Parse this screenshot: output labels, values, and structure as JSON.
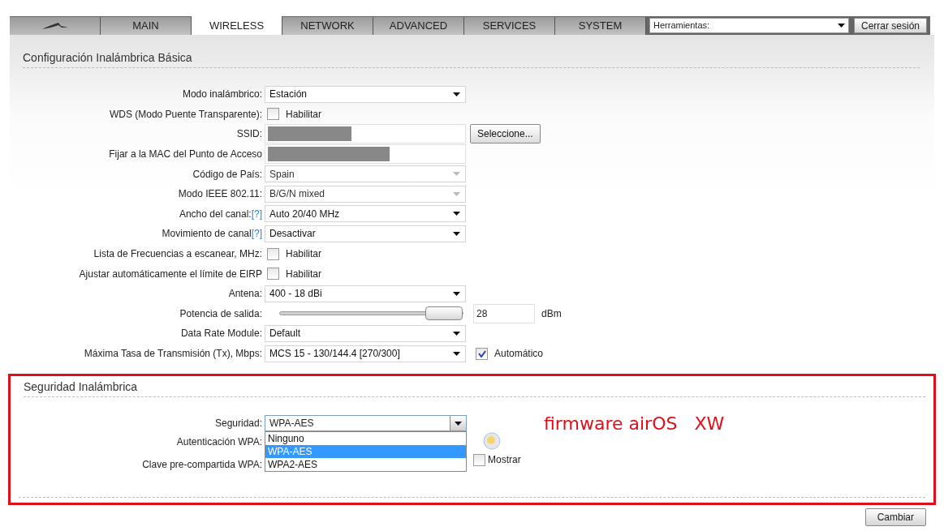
{
  "tabs": [
    {
      "label": "MAIN",
      "selected": false
    },
    {
      "label": "WIRELESS",
      "selected": true
    },
    {
      "label": "NETWORK",
      "selected": false
    },
    {
      "label": "ADVANCED",
      "selected": false
    },
    {
      "label": "SERVICES",
      "selected": false
    },
    {
      "label": "SYSTEM",
      "selected": false
    }
  ],
  "tools_select": {
    "value": "Herramientas:"
  },
  "logout_button": "Cerrar sesión",
  "basic_section": {
    "title": "Configuración Inalámbrica Básica",
    "rows": [
      {
        "kind": "select",
        "label": "Modo inalámbrico:",
        "value": "Estación",
        "disabled": false
      },
      {
        "kind": "checkbox",
        "label": "WDS (Modo Puente Transparente):",
        "text": "Habilitar",
        "checked": false
      },
      {
        "kind": "masked",
        "label": "SSID:",
        "button": "Seleccione..."
      },
      {
        "kind": "masked",
        "label": "Fijar a la MAC del Punto de Acceso"
      },
      {
        "kind": "select",
        "label": "Código de País:",
        "value": "Spain",
        "disabled": true
      },
      {
        "kind": "select",
        "label": "Modo IEEE 802.11:",
        "value": "B/G/N mixed",
        "disabled": true
      },
      {
        "kind": "select",
        "label": "Ancho del canal:",
        "help": "[?]",
        "value": "Auto 20/40 MHz",
        "disabled": false
      },
      {
        "kind": "select",
        "label": "Movimiento de canal",
        "help": "[?]",
        "value": "Desactivar",
        "disabled": false
      },
      {
        "kind": "checkbox",
        "label": "Lista de Frecuencias a escanear, MHz:",
        "text": "Habilitar",
        "checked": false
      },
      {
        "kind": "checkbox",
        "label": "Ajustar automáticamente el límite de EIRP",
        "text": "Habilitar",
        "checked": false
      },
      {
        "kind": "select",
        "label": "Antena:",
        "value": "400 - 18 dBi",
        "disabled": false
      },
      {
        "kind": "slider",
        "label": "Potencia de salida:",
        "level": 1,
        "value": "28",
        "unit": "dBm"
      },
      {
        "kind": "select",
        "label": "Data Rate Module:",
        "value": "Default",
        "disabled": false
      },
      {
        "kind": "select",
        "label": "Máxima Tasa de Transmisión (Tx), Mbps:",
        "value": "MCS 15 - 130/144.4 [270/300]",
        "disabled": false,
        "check": {
          "text": "Automático",
          "checked": true
        }
      }
    ]
  },
  "security_section": {
    "title": "Seguridad Inalámbrica",
    "security_label": "Seguridad:",
    "security_value": "WPA-AES",
    "options": [
      {
        "label": "Ninguno",
        "selected": false
      },
      {
        "label": "WPA-AES",
        "selected": true
      },
      {
        "label": "WPA2-AES",
        "selected": false
      }
    ],
    "auth_label": "Autenticación WPA:",
    "key_label": "Clave pre-compartida WPA:",
    "show_check": {
      "text": "Mostrar",
      "checked": false
    }
  },
  "annotation": "firmware airOS   XW",
  "apply_button": "Cambiar"
}
